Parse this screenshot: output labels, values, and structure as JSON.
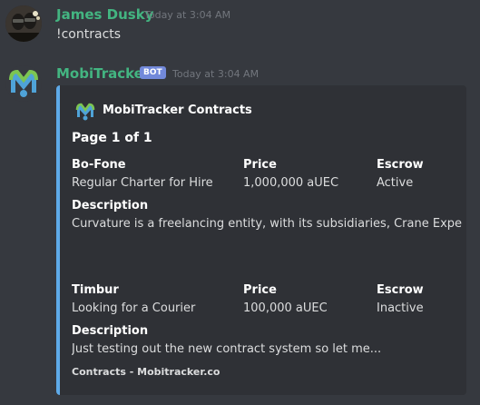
{
  "messages": [
    {
      "author": "James Dusky",
      "timestamp": "Today at 3:04 AM",
      "content": "!contracts",
      "author_color": "#43b581"
    },
    {
      "author": "MobiTracker",
      "badge": "BOT",
      "timestamp": "Today at 3:04 AM",
      "author_color": "#43b581"
    }
  ],
  "embed": {
    "accent_color": "#5eaae8",
    "author": "MobiTracker Contracts",
    "author_icon": "mobitracker-logo-icon",
    "title": "Page 1 of 1",
    "contracts": [
      {
        "name_header": "Bo-Fone",
        "name_value": "Regular Charter for Hire",
        "price_header": "Price",
        "price_value": "1,000,000 aUEC",
        "escrow_header": "Escrow",
        "escrow_value": "Active",
        "description_header": "Description",
        "description_value": "Curvature is a freelancing entity, with its subsidiaries, Crane Expedition,..."
      },
      {
        "name_header": "Timbur",
        "name_value": "Looking for a Courier",
        "price_header": "Price",
        "price_value": "100,000 aUEC",
        "escrow_header": "Escrow",
        "escrow_value": "Inactive",
        "description_header": "Description",
        "description_value": "Just testing out the new contract system so let me..."
      }
    ],
    "footer": "Contracts - Mobitracker.co"
  }
}
